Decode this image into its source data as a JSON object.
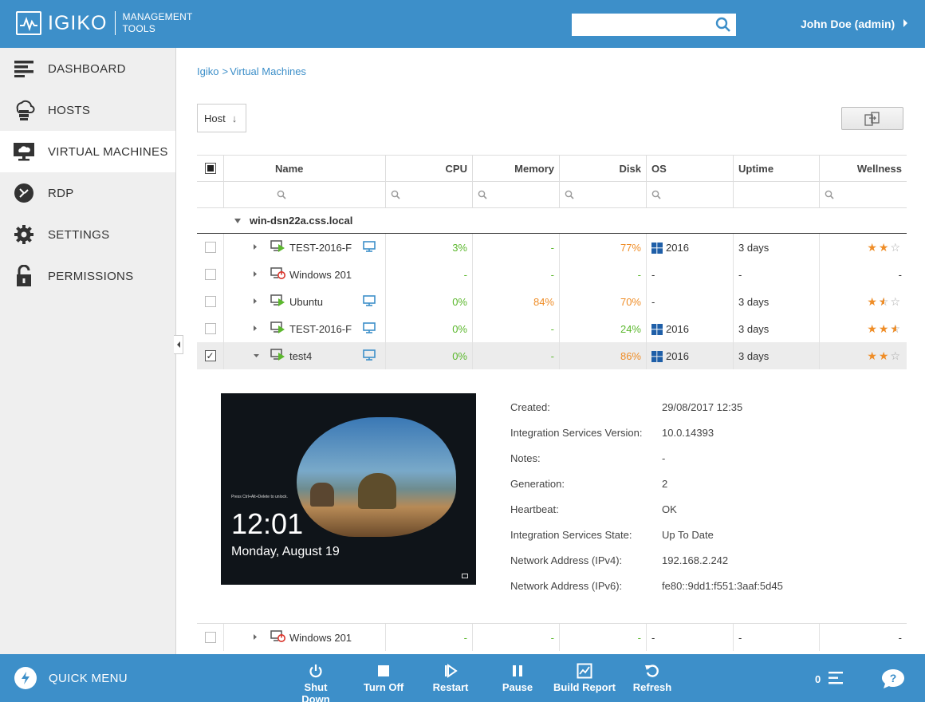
{
  "header": {
    "logo_text": "IGIKO",
    "logo_sub_line1": "MANAGEMENT",
    "logo_sub_line2": "TOOLS",
    "search_placeholder": "",
    "user": "John Doe (admin)"
  },
  "sidebar": {
    "items": [
      {
        "label": "DASHBOARD",
        "icon": "dashboard-icon"
      },
      {
        "label": "HOSTS",
        "icon": "hosts-icon"
      },
      {
        "label": "VIRTUAL MACHINES",
        "icon": "virtual-machines-icon",
        "active": true
      },
      {
        "label": "RDP",
        "icon": "rdp-icon"
      },
      {
        "label": "SETTINGS",
        "icon": "gear-icon"
      },
      {
        "label": "PERMISSIONS",
        "icon": "lock-icon"
      }
    ]
  },
  "breadcrumb": {
    "root": "Igiko",
    "sep": ">",
    "current": "Virtual Machines"
  },
  "toolbar": {
    "group_by": "Host",
    "sort_arrow": "↓"
  },
  "table": {
    "columns": [
      "Name",
      "CPU",
      "Memory",
      "Disk",
      "OS",
      "Uptime",
      "Wellness"
    ],
    "group": "win-dsn22a.css.local",
    "rows": [
      {
        "name": "TEST-2016-F",
        "state": "running",
        "console": true,
        "cpu": "3%",
        "memory": "-",
        "disk": "77%",
        "os": "2016",
        "os_windows": true,
        "uptime": "3 days",
        "wellness": 2
      },
      {
        "name": "Windows 201",
        "state": "off",
        "console": false,
        "cpu": "-",
        "memory": "-",
        "disk": "-",
        "os": "-",
        "os_windows": false,
        "uptime": "-",
        "wellness": null,
        "wellness_text": "-"
      },
      {
        "name": "Ubuntu",
        "state": "running",
        "console": true,
        "cpu": "0%",
        "memory": "84%",
        "disk": "70%",
        "os": "-",
        "os_windows": false,
        "uptime": "3 days",
        "wellness": 1.5
      },
      {
        "name": "TEST-2016-F",
        "state": "running",
        "console": true,
        "cpu": "0%",
        "memory": "-",
        "disk": "24%",
        "os": "2016",
        "os_windows": true,
        "uptime": "3 days",
        "wellness": 2.5
      },
      {
        "name": "test4",
        "state": "running",
        "console": true,
        "selected": true,
        "expanded": true,
        "cpu": "0%",
        "memory": "-",
        "disk": "86%",
        "os": "2016",
        "os_windows": true,
        "uptime": "3 days",
        "wellness": 2
      }
    ],
    "last_row": {
      "name": "Windows 201",
      "state": "off",
      "cpu": "-",
      "memory": "-",
      "disk": "-",
      "os": "-",
      "uptime": "-",
      "wellness_text": "-"
    }
  },
  "detail": {
    "preview": {
      "hint": "Press Ctrl+Alt+Delete to unlock.",
      "time": "12:01",
      "date": "Monday, August 19"
    },
    "properties": [
      {
        "key": "Created:",
        "value": "29/08/2017 12:35"
      },
      {
        "key": "Integration Services Version:",
        "value": "10.0.14393"
      },
      {
        "key": "Notes:",
        "value": "-"
      },
      {
        "key": "Generation:",
        "value": "2"
      },
      {
        "key": "Heartbeat:",
        "value": "OK"
      },
      {
        "key": "Integration Services State:",
        "value": "Up To Date"
      },
      {
        "key": "Network Address (IPv4):",
        "value": "192.168.2.242"
      },
      {
        "key": "Network Address (IPv6):",
        "value": "fe80::9dd1:f551:3aaf:5d45"
      }
    ]
  },
  "bottombar": {
    "quick_menu": "QUICK MENU",
    "actions": [
      {
        "label": "Shut Down",
        "icon": "power-icon"
      },
      {
        "label": "Turn Off",
        "icon": "stop-icon"
      },
      {
        "label": "Restart",
        "icon": "restart-icon"
      },
      {
        "label": "Pause",
        "icon": "pause-icon"
      },
      {
        "label": "Build Report",
        "icon": "report-icon"
      },
      {
        "label": "Refresh",
        "icon": "refresh-icon"
      }
    ],
    "count": "0"
  },
  "colors": {
    "brand": "#3d8fc9",
    "green": "#5cb82e",
    "orange": "#ef8d27",
    "power_red": "#d9342b"
  }
}
